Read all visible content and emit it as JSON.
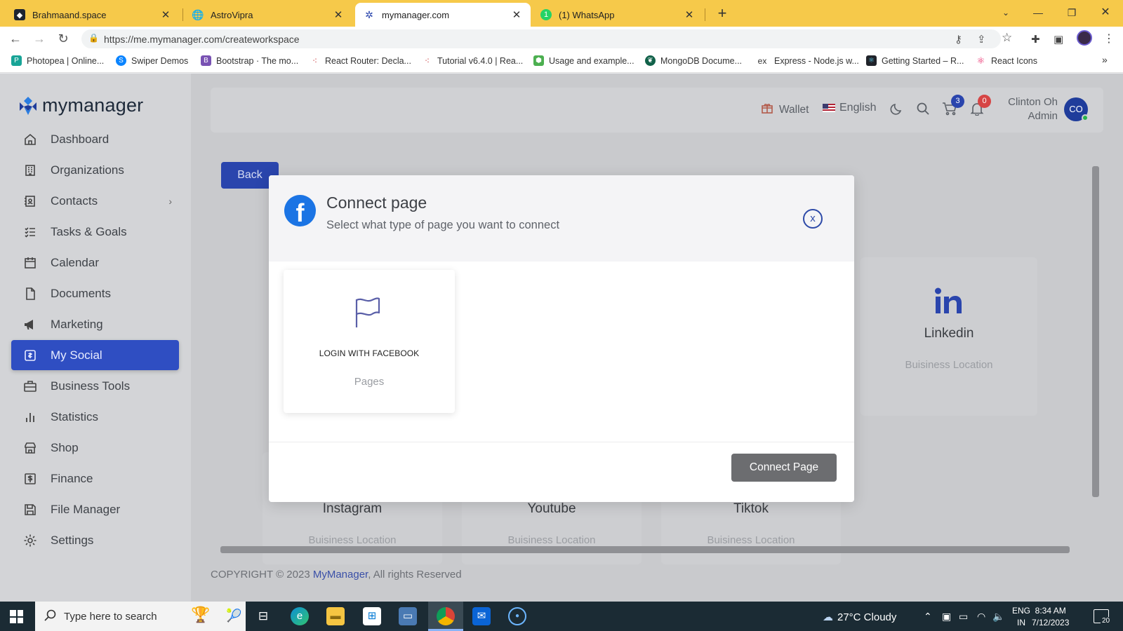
{
  "browser": {
    "tabs": [
      {
        "title": "Brahmaand.space",
        "icon": "brahmaand-favicon"
      },
      {
        "title": "AstroVipra",
        "icon": "globe-icon"
      },
      {
        "title": "mymanager.com",
        "icon": "mymanager-favicon"
      },
      {
        "title": "(1) WhatsApp",
        "icon": "whatsapp-favicon"
      }
    ],
    "url": "https://me.mymanager.com/createworkspace",
    "bookmarks": [
      {
        "label": "Photopea | Online...",
        "color": "#18a497"
      },
      {
        "label": "Swiper Demos",
        "color": "#0a84ff"
      },
      {
        "label": "Bootstrap · The mo...",
        "color": "#7952b3"
      },
      {
        "label": "React Router: Decla...",
        "color": "#ca4245"
      },
      {
        "label": "Tutorial v6.4.0 | Rea...",
        "color": "#ca4245"
      },
      {
        "label": "Usage and example...",
        "color": "#4caf50"
      },
      {
        "label": "MongoDB Docume...",
        "color": "#116149"
      },
      {
        "label": "Express - Node.js w...",
        "color": "#333333"
      },
      {
        "label": "Getting Started – R...",
        "color": "#20232a"
      },
      {
        "label": "React Icons",
        "color": "#e91e63"
      }
    ]
  },
  "app": {
    "brand": "mymanager",
    "nav": [
      {
        "label": "Dashboard",
        "icon": "home-icon"
      },
      {
        "label": "Organizations",
        "icon": "building-icon"
      },
      {
        "label": "Contacts",
        "icon": "contacts-icon"
      },
      {
        "label": "Tasks & Goals",
        "icon": "tasks-icon"
      },
      {
        "label": "Calendar",
        "icon": "calendar-icon"
      },
      {
        "label": "Documents",
        "icon": "document-icon"
      },
      {
        "label": "Marketing",
        "icon": "megaphone-icon"
      },
      {
        "label": "My Social",
        "icon": "social-icon"
      },
      {
        "label": "Business Tools",
        "icon": "briefcase-icon"
      },
      {
        "label": "Statistics",
        "icon": "bar-chart-icon"
      },
      {
        "label": "Shop",
        "icon": "store-icon"
      },
      {
        "label": "Finance",
        "icon": "dollar-icon"
      },
      {
        "label": "File Manager",
        "icon": "save-icon"
      },
      {
        "label": "Settings",
        "icon": "gear-icon"
      }
    ],
    "active_nav": "My Social",
    "header": {
      "wallet": "Wallet",
      "language": "English",
      "cart_count": "3",
      "notification_count": "0",
      "user_name": "Clinton Oh",
      "user_role": "Admin",
      "avatar_initials": "CO"
    },
    "back_label": "Back",
    "cards": [
      {
        "title": "Linkedin",
        "sub": "Buisiness Location"
      },
      {
        "title": "Instagram",
        "sub": "Buisiness Location"
      },
      {
        "title": "Youtube",
        "sub": "Buisiness Location"
      },
      {
        "title": "Tiktok",
        "sub": "Buisiness Location"
      }
    ],
    "footer": {
      "prefix": "COPYRIGHT © 2023 ",
      "brand": "MyManager",
      "suffix": ", All rights Reserved"
    }
  },
  "modal": {
    "title": "Connect page",
    "subtitle": "Select what type of page you want to connect",
    "option_label": "LOGIN WITH FACEBOOK",
    "option_sub": "Pages",
    "connect_label": "Connect Page",
    "close_glyph": "x"
  },
  "taskbar": {
    "search_placeholder": "Type here to search",
    "weather": "27°C  Cloudy",
    "lang_top": "ENG",
    "lang_bottom": "IN",
    "time": "8:34 AM",
    "date": "7/12/2023",
    "notif_count": "20"
  },
  "colors": {
    "tab_bar": "#f6c94a",
    "accent": "#2f4ec2",
    "facebook": "#1b74e4"
  }
}
